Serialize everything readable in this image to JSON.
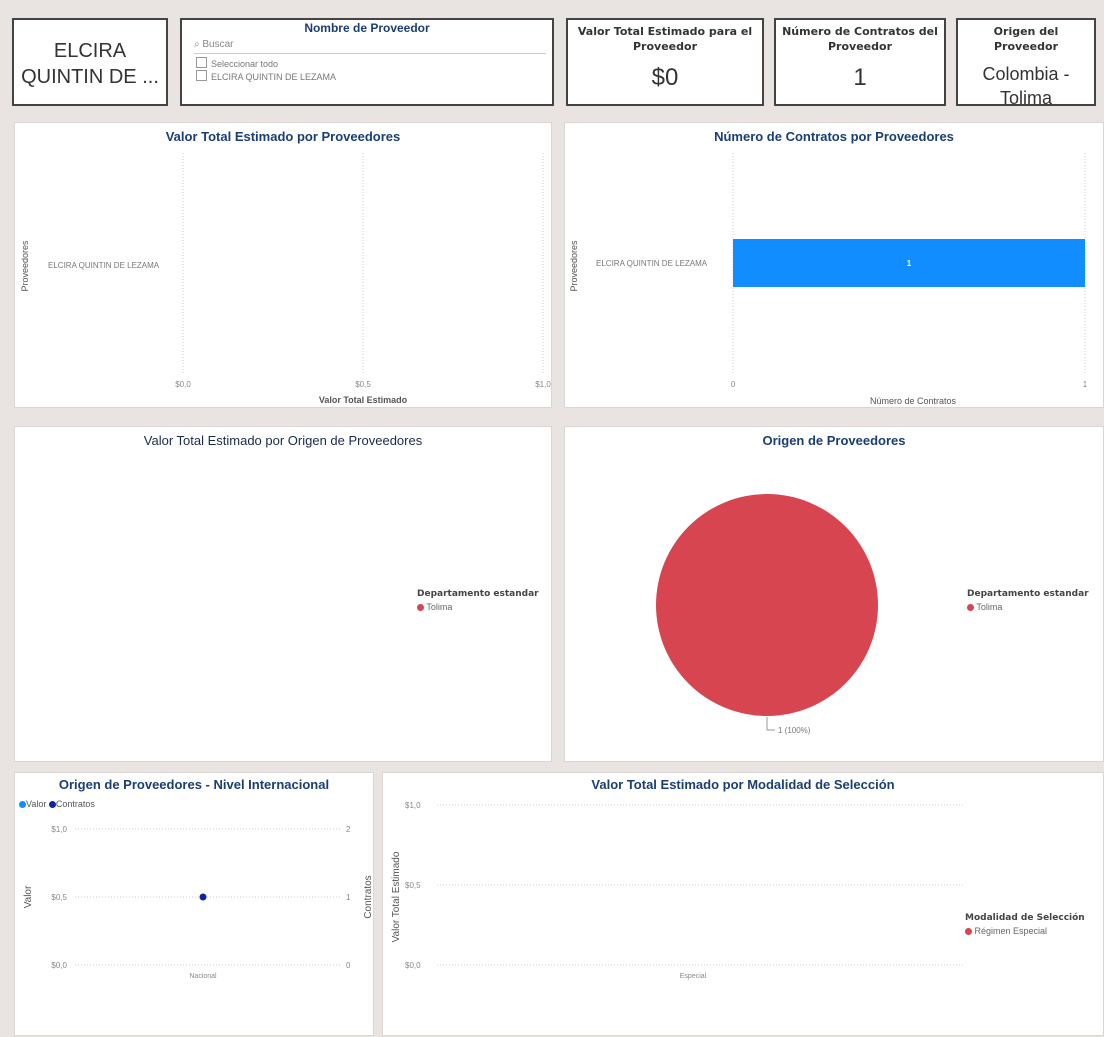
{
  "card_name": "ELCIRA QUINTIN DE ...",
  "slicer": {
    "title": "Nombre de Proveedor",
    "search_placeholder": "Buscar",
    "select_all": "Seleccionar todo",
    "items": [
      "ELCIRA QUINTIN DE LEZAMA"
    ]
  },
  "kpis": [
    {
      "title": "Valor Total Estimado para el Proveedor",
      "value": "$0"
    },
    {
      "title": "Número de Contratos del Proveedor",
      "value": "1"
    },
    {
      "title": "Origen del Proveedor",
      "value": "Colombia - Tolima"
    }
  ],
  "colors": {
    "title": "#1a3e73",
    "bar": "#118dff",
    "pie": "#d64550",
    "valor": "#118dff",
    "contratos": "#12239e",
    "legend_red": "#d64550"
  },
  "chart_data": [
    {
      "type": "bar",
      "title": "Valor Total Estimado por Proveedores",
      "categories": [
        "ELCIRA QUINTIN DE LEZAMA"
      ],
      "values": [
        0
      ],
      "xlabel": "Valor Total Estimado",
      "ylabel": "Proveedores",
      "xticks": [
        "$0,0",
        "$0,5",
        "$1,0"
      ],
      "xlim": [
        0,
        1
      ]
    },
    {
      "type": "bar",
      "title": "Número de Contratos por Proveedores",
      "categories": [
        "ELCIRA QUINTIN DE LEZAMA"
      ],
      "values": [
        1
      ],
      "data_labels": [
        "1"
      ],
      "xlabel": "Número de Contratos",
      "ylabel": "Proveedores",
      "xticks": [
        "0",
        "1"
      ],
      "xlim": [
        0,
        1
      ]
    },
    {
      "type": "pie",
      "title": "Valor Total Estimado por Origen de Proveedores",
      "legend_title": "Departamento estandar",
      "legend": [
        "Tolima"
      ],
      "values": []
    },
    {
      "type": "pie",
      "title": "Origen de Proveedores",
      "legend_title": "Departamento estandar",
      "legend": [
        "Tolima"
      ],
      "values": [
        1
      ],
      "data_labels": [
        "1 (100%)"
      ]
    },
    {
      "type": "line",
      "title": "Origen de Proveedores - Nivel Internacional",
      "legend": [
        "Valor",
        "Contratos"
      ],
      "categories": [
        "Nacional"
      ],
      "series": [
        {
          "name": "Valor",
          "values": [
            0
          ]
        },
        {
          "name": "Contratos",
          "values": [
            1
          ]
        }
      ],
      "ylabel": "Valor",
      "y2label": "Contratos",
      "yticks": [
        "$0,0",
        "$0,5",
        "$1,0"
      ],
      "y2ticks": [
        "0",
        "1",
        "2"
      ],
      "ylim": [
        0,
        1
      ],
      "y2lim": [
        0,
        2
      ]
    },
    {
      "type": "bar",
      "title": "Valor Total Estimado por Modalidad de Selección",
      "categories": [
        "Especial"
      ],
      "values": [
        0
      ],
      "ylabel": "Valor Total Estimado",
      "yticks": [
        "$0,0",
        "$0,5",
        "$1,0"
      ],
      "ylim": [
        0,
        1
      ],
      "legend_title": "Modalidad de Selección",
      "legend": [
        "Régimen Especial"
      ]
    }
  ]
}
